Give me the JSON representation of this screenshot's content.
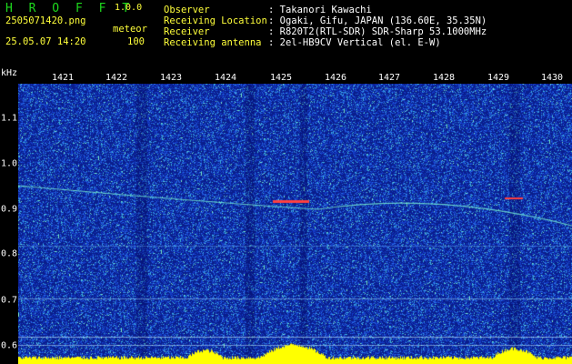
{
  "app": {
    "name": "H R O F F T",
    "version": "1.0.0"
  },
  "file": {
    "name": "2505071420.png",
    "datetime": "25.05.07 14:20"
  },
  "detection": {
    "label": "meteor",
    "count": "100"
  },
  "info": {
    "observer_label": "Observer",
    "observer_value": ": Takanori Kawachi",
    "location_label": "Receiving Location",
    "location_value": ": Ogaki, Gifu, JAPAN (136.60E, 35.35N)",
    "receiver_label": "Receiver",
    "receiver_value": ": R820T2(RTL-SDR) SDR-Sharp 53.1000MHz",
    "antenna_label": "Receiving antenna",
    "antenna_value": ": 2el-HB9CV Vertical (el. E-W)"
  },
  "axes": {
    "y_unit": "kHz",
    "x_ticks": [
      "1421",
      "1422",
      "1423",
      "1424",
      "1425",
      "1426",
      "1427",
      "1428",
      "1429",
      "1430"
    ],
    "y_ticks": [
      "1.1",
      "1.0",
      "0.9",
      "0.8",
      "0.7",
      "0.6"
    ]
  },
  "colors": {
    "background": "#000000",
    "waterfall": "#0a1f8a",
    "signal": "#ffff00",
    "title": "#1dd81d"
  }
}
